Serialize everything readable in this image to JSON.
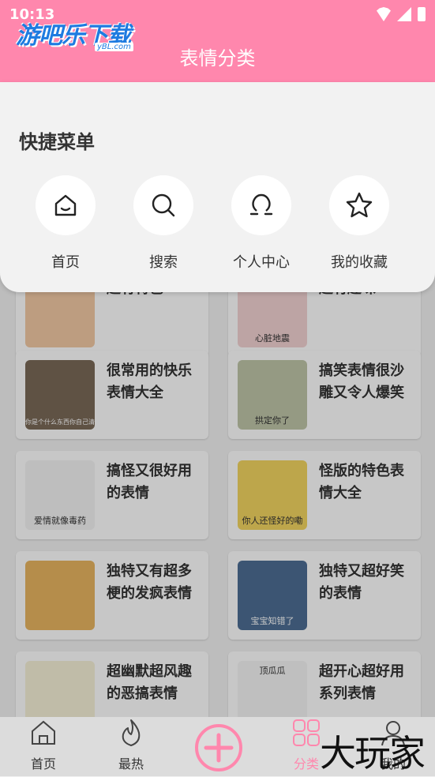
{
  "status": {
    "time": "10:13"
  },
  "header": {
    "logo_text": "游吧乐下载",
    "logo_sub": "yBL.com",
    "title": "表情分类"
  },
  "popup": {
    "title": "快捷菜单",
    "items": [
      {
        "label": "首页",
        "icon": "home-icon"
      },
      {
        "label": "搜索",
        "icon": "search-icon"
      },
      {
        "label": "个人中心",
        "icon": "user-icon"
      },
      {
        "label": "我的收藏",
        "icon": "star-icon"
      }
    ]
  },
  "cards": [
    {
      "title": "超有特色",
      "caption": "",
      "bg": "#f2c9a4"
    },
    {
      "title": "超有趣味",
      "caption": "心脏地震",
      "bg": "#f3d2d2"
    },
    {
      "title": "很常用的快乐表情大全",
      "caption": "你是个什么东西你自己清楚",
      "bg": "#7a6a58"
    },
    {
      "title": "搞笑表情很沙雕又令人爆笑",
      "caption": "拱定你了",
      "bg": "#bfc6a8"
    },
    {
      "title": "搞怪又很好用的表情",
      "caption": "爱情就像毒药",
      "bg": "#f4f4f4"
    },
    {
      "title": "怪版的特色表情大全",
      "caption": "你人还怪好的嘞",
      "bg": "#f3d560"
    },
    {
      "title": "独特又有超多梗的发疯表情",
      "caption": "",
      "bg": "#e8b560"
    },
    {
      "title": "独特又超好笑的表情",
      "caption": "宝宝知错了",
      "bg": "#4d6e94"
    },
    {
      "title": "超幽默超风趣的恶搞表情",
      "caption": "",
      "bg": "#f6f1d8"
    },
    {
      "title": "超开心超好用系列表情",
      "caption": "顶瓜瓜",
      "bg": "#f5f5f5"
    }
  ],
  "tabbar": {
    "items": [
      {
        "label": "首页",
        "icon": "home-icon"
      },
      {
        "label": "最热",
        "icon": "flame-icon"
      },
      {
        "label": "分类",
        "icon": "grid-icon",
        "active": true
      },
      {
        "label": "我的",
        "icon": "user-icon"
      }
    ],
    "center_icon": "add-icon"
  },
  "watermark": "大玩家",
  "colors": {
    "accent": "#ff87ad"
  }
}
